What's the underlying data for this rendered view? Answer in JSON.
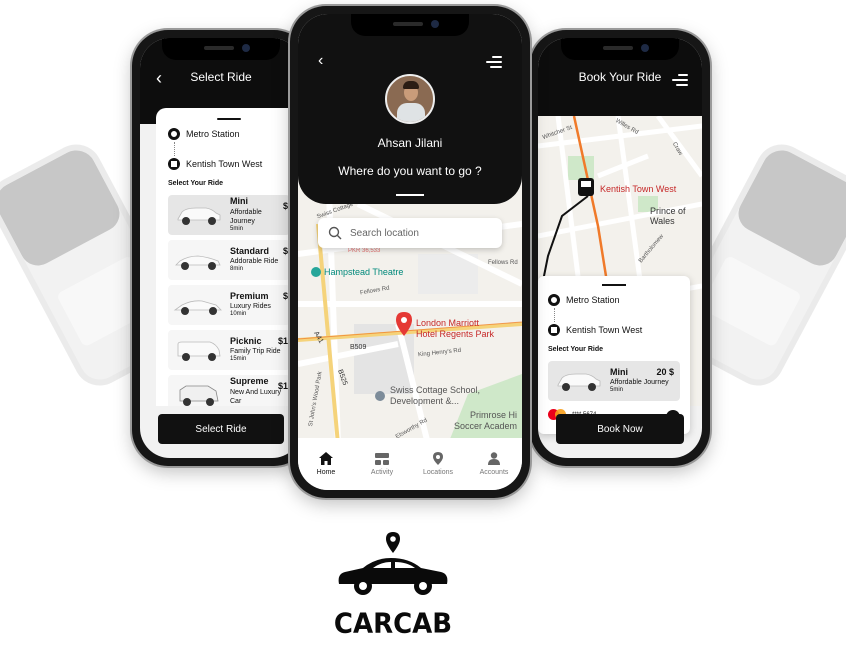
{
  "brand": {
    "name": "CARCAB",
    "icon": "car-with-location-pin-icon",
    "color": "#0a0a0a"
  },
  "colors": {
    "dark": "#111111",
    "accent_route": "#f07a2a",
    "pin": "#e53935",
    "park": "#cfe8c9"
  },
  "select_ride": {
    "title": "Select Ride",
    "back_icon": "chevron-left-icon",
    "pickup": "Metro Station",
    "dropoff": "Kentish Town West",
    "section_title": "Select Your Ride",
    "rides": [
      {
        "name": "Mini",
        "desc": "Affordable Journey",
        "eta": "5min",
        "price": "$"
      },
      {
        "name": "Standard",
        "desc": "Addorable Ride",
        "eta": "8min",
        "price": "$"
      },
      {
        "name": "Premium",
        "desc": "Luxury Rides",
        "eta": "10min",
        "price": "$"
      },
      {
        "name": "Picknic",
        "desc": "Family Trip Ride",
        "eta": "15min",
        "price": "$1"
      },
      {
        "name": "Supreme",
        "desc": "New And Luxury Car",
        "eta": "20min",
        "price": "$1"
      }
    ],
    "button": "Select Ride"
  },
  "home": {
    "back_icon": "chevron-left-icon",
    "menu_icon": "menu-icon",
    "user_name": "Ahsan Jilani",
    "question": "Where do you want to go ?",
    "search_placeholder": "Search location",
    "map_labels": {
      "pin_place_1": "London Marriott",
      "pin_place_2": "Hotel Regents Park",
      "theatre": "Hampstead Theatre",
      "school_1": "Swiss Cottage School,",
      "school_2": "Development &...",
      "primrose_1": "Primrose Hi",
      "primrose_2": "Soccer Academ",
      "b509": "B509",
      "b525": "B525",
      "a41": "A41",
      "fellows_rd": "Fellows Rd",
      "fellows_rd_2": "Fellows Rd",
      "king_henrys": "King Henry's Rd",
      "st_johns": "St John's Wood Park",
      "elsworthy": "Elsworthy Rd",
      "swiss_cottage": "Swiss Cottage",
      "pkr": "PKR 36,533"
    },
    "tabs": [
      {
        "label": "Home",
        "icon": "home-icon",
        "active": true
      },
      {
        "label": "Activity",
        "icon": "activity-icon",
        "active": false
      },
      {
        "label": "Locations",
        "icon": "location-pin-icon",
        "active": false
      },
      {
        "label": "Accounts",
        "icon": "user-icon",
        "active": false
      }
    ]
  },
  "book_ride": {
    "title": "Book Your Ride",
    "menu_icon": "menu-icon",
    "map_labels": {
      "kentish": "Kentish Town West",
      "prince": "Prince of Wales",
      "willes": "Willes Rd",
      "whitcher": "Whitcher St",
      "bartholomew": "Bartholomew",
      "craw": "Craw"
    },
    "pickup": "Metro Station",
    "dropoff": "Kentish Town West",
    "section_title": "Select Your Ride",
    "ride": {
      "name": "Mini",
      "price": "20 $",
      "desc": "Affordable Journey",
      "eta": "5min"
    },
    "card_number": "**** 5674",
    "button": "Book Now"
  }
}
